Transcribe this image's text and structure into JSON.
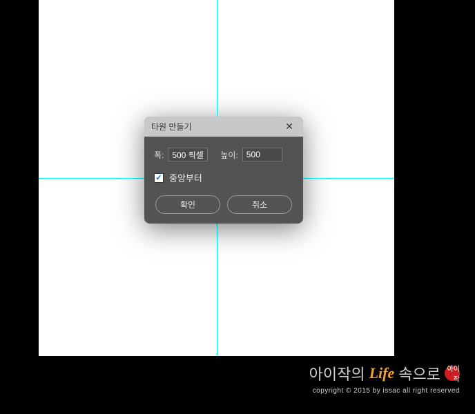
{
  "dialog": {
    "title": "타원 만들기",
    "width_label": "폭:",
    "width_value": "500 픽셀",
    "height_label": "높이:",
    "height_value": "500",
    "from_center_label": "중앙부터",
    "from_center_checked": true,
    "ok_label": "확인",
    "cancel_label": "취소"
  },
  "watermark": {
    "part1": "아이작의",
    "accent": "Life",
    "part2": "속으로",
    "stamp": "아이작",
    "copyright": "copyright © 2015 by issac all right reserved"
  }
}
